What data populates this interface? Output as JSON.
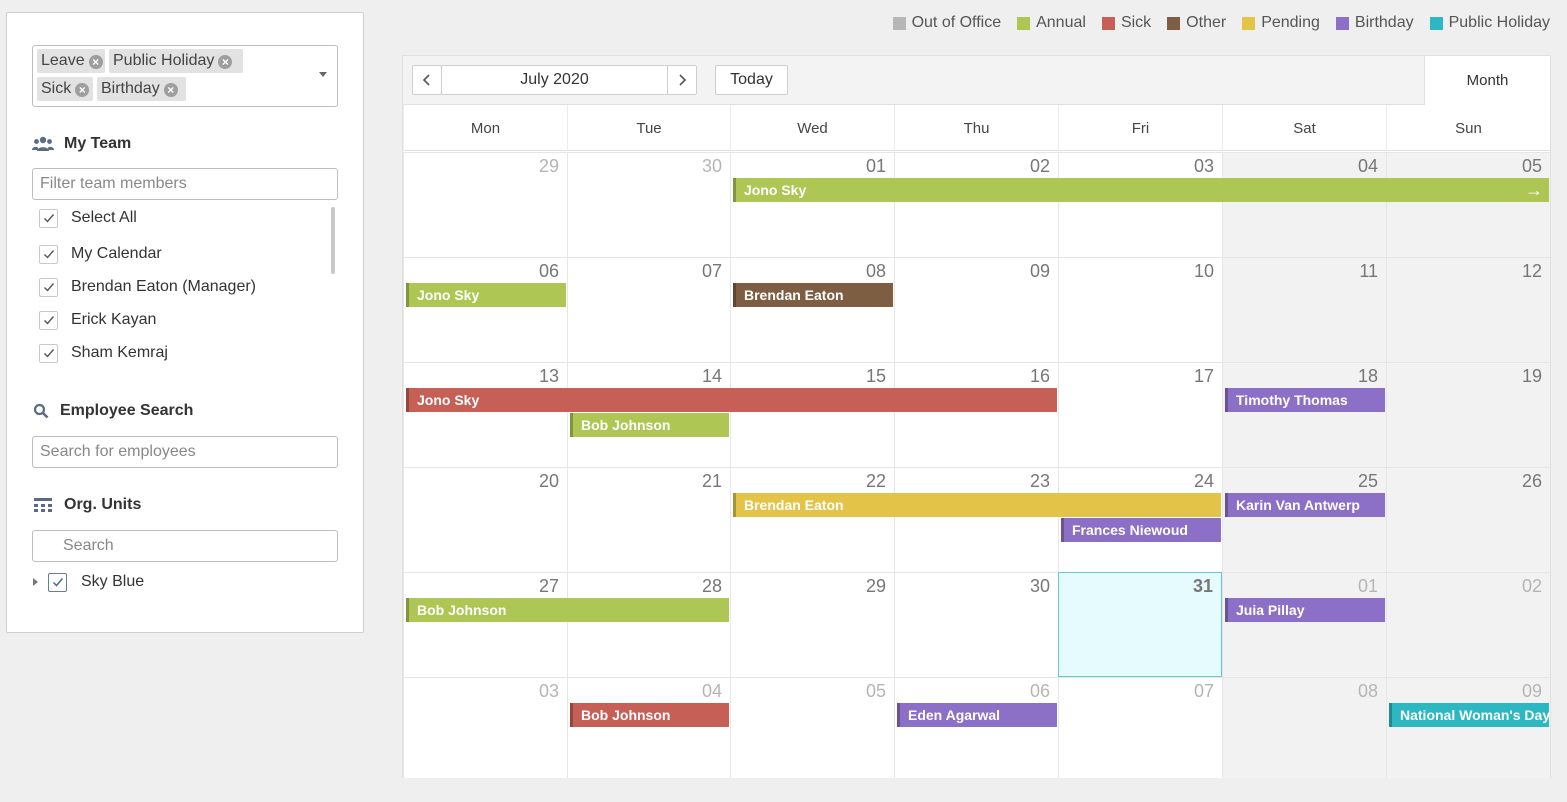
{
  "filters": {
    "chips": [
      {
        "label": "Leave"
      },
      {
        "label": "Public Holiday"
      },
      {
        "label": "Sick"
      },
      {
        "label": "Birthday"
      }
    ]
  },
  "my_team": {
    "title": "My Team",
    "filter_placeholder": "Filter team members",
    "items": [
      {
        "label": "Select All",
        "checked": true
      },
      {
        "label": "My Calendar",
        "checked": true
      },
      {
        "label": "Brendan Eaton (Manager)",
        "checked": true
      },
      {
        "label": "Erick Kayan",
        "checked": true
      },
      {
        "label": "Sham Kemraj",
        "checked": true
      }
    ]
  },
  "employee_search": {
    "title": "Employee Search",
    "placeholder": "Search for employees"
  },
  "org_units": {
    "title": "Org. Units",
    "placeholder": "Search",
    "tree": [
      {
        "label": "Sky Blue",
        "checked": true
      }
    ]
  },
  "legend": [
    {
      "label": "Out of Office",
      "color": "#b7b7b7"
    },
    {
      "label": "Annual",
      "color": "#adc654"
    },
    {
      "label": "Sick",
      "color": "#c65f56"
    },
    {
      "label": "Other",
      "color": "#7d5e43"
    },
    {
      "label": "Pending",
      "color": "#e3c448"
    },
    {
      "label": "Birthday",
      "color": "#8c6fc6"
    },
    {
      "label": "Public Holiday",
      "color": "#2cb7c2"
    }
  ],
  "toolbar": {
    "prev": "‹",
    "next": "›",
    "period": "July 2020",
    "today_label": "Today",
    "view_label": "Month"
  },
  "weekdays": [
    "Mon",
    "Tue",
    "Wed",
    "Thu",
    "Fri",
    "Sat",
    "Sun"
  ],
  "weeks": [
    [
      {
        "d": "29",
        "other": true
      },
      {
        "d": "30",
        "other": true
      },
      {
        "d": "01"
      },
      {
        "d": "02"
      },
      {
        "d": "03"
      },
      {
        "d": "04"
      },
      {
        "d": "05"
      }
    ],
    [
      {
        "d": "06"
      },
      {
        "d": "07"
      },
      {
        "d": "08"
      },
      {
        "d": "09"
      },
      {
        "d": "10"
      },
      {
        "d": "11"
      },
      {
        "d": "12"
      }
    ],
    [
      {
        "d": "13"
      },
      {
        "d": "14"
      },
      {
        "d": "15"
      },
      {
        "d": "16"
      },
      {
        "d": "17"
      },
      {
        "d": "18"
      },
      {
        "d": "19"
      }
    ],
    [
      {
        "d": "20"
      },
      {
        "d": "21"
      },
      {
        "d": "22"
      },
      {
        "d": "23"
      },
      {
        "d": "24"
      },
      {
        "d": "25"
      },
      {
        "d": "26"
      }
    ],
    [
      {
        "d": "27"
      },
      {
        "d": "28"
      },
      {
        "d": "29"
      },
      {
        "d": "30"
      },
      {
        "d": "31",
        "today": true
      },
      {
        "d": "01",
        "other": true
      },
      {
        "d": "02",
        "other": true
      }
    ],
    [
      {
        "d": "03",
        "other": true
      },
      {
        "d": "04",
        "other": true
      },
      {
        "d": "05",
        "other": true
      },
      {
        "d": "06",
        "other": true
      },
      {
        "d": "07",
        "other": true
      },
      {
        "d": "08",
        "other": true
      },
      {
        "d": "09",
        "other": true
      }
    ]
  ],
  "events": [
    {
      "name": "Jono Sky",
      "type": "Annual",
      "color": "#adc654",
      "week": 0,
      "start": 2,
      "span": 5,
      "lane": 0,
      "continues": true
    },
    {
      "name": "Jono Sky",
      "type": "Annual",
      "color": "#adc654",
      "week": 1,
      "start": 0,
      "span": 1,
      "lane": 0
    },
    {
      "name": "Brendan Eaton",
      "type": "Other",
      "color": "#7d5e43",
      "week": 1,
      "start": 2,
      "span": 1,
      "lane": 0
    },
    {
      "name": "Jono Sky",
      "type": "Sick",
      "color": "#c65f56",
      "week": 2,
      "start": 0,
      "span": 4,
      "lane": 0
    },
    {
      "name": "Timothy Thomas",
      "type": "Birthday",
      "color": "#8c6fc6",
      "week": 2,
      "start": 5,
      "span": 1,
      "lane": 0
    },
    {
      "name": "Bob Johnson",
      "type": "Annual",
      "color": "#adc654",
      "week": 2,
      "start": 1,
      "span": 1,
      "lane": 1
    },
    {
      "name": "Brendan Eaton",
      "type": "Pending",
      "color": "#e3c448",
      "week": 3,
      "start": 2,
      "span": 3,
      "lane": 0
    },
    {
      "name": "Karin Van Antwerp",
      "type": "Birthday",
      "color": "#8c6fc6",
      "week": 3,
      "start": 5,
      "span": 1,
      "lane": 0
    },
    {
      "name": "Frances Niewoud",
      "type": "Birthday",
      "color": "#8c6fc6",
      "week": 3,
      "start": 4,
      "span": 1,
      "lane": 1
    },
    {
      "name": "Bob Johnson",
      "type": "Annual",
      "color": "#adc654",
      "week": 4,
      "start": 0,
      "span": 2,
      "lane": 0
    },
    {
      "name": "Juia Pillay",
      "type": "Birthday",
      "color": "#8c6fc6",
      "week": 4,
      "start": 5,
      "span": 1,
      "lane": 0
    },
    {
      "name": "Bob Johnson",
      "type": "Sick",
      "color": "#c65f56",
      "week": 5,
      "start": 1,
      "span": 1,
      "lane": 0
    },
    {
      "name": "Eden Agarwal",
      "type": "Birthday",
      "color": "#8c6fc6",
      "week": 5,
      "start": 3,
      "span": 1,
      "lane": 0
    },
    {
      "name": "National Woman's Day",
      "type": "Public Holiday",
      "color": "#2cb7c2",
      "week": 5,
      "start": 6,
      "span": 1,
      "lane": 0
    }
  ]
}
